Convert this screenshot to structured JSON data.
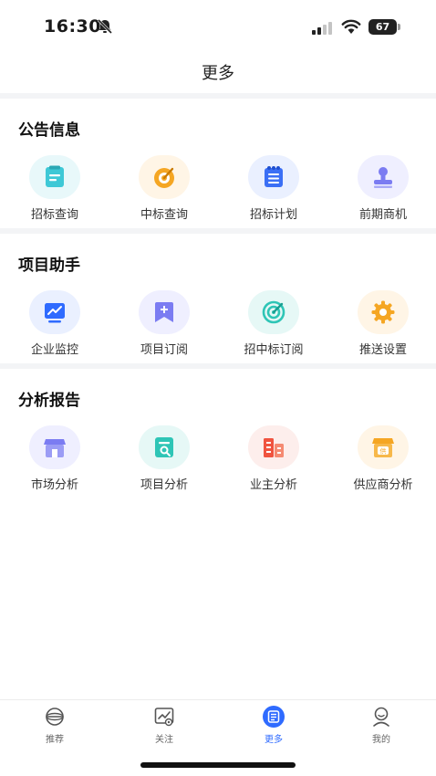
{
  "status_bar": {
    "time": "16:30",
    "battery": "67"
  },
  "header": {
    "title": "更多"
  },
  "sections": [
    {
      "title": "公告信息",
      "items": [
        {
          "label": "招标查询",
          "icon": "document-list-icon",
          "color": "#3ec8d6"
        },
        {
          "label": "中标查询",
          "icon": "target-dart-icon",
          "color": "#f5a623"
        },
        {
          "label": "招标计划",
          "icon": "notebook-icon",
          "color": "#3b6ff5"
        },
        {
          "label": "前期商机",
          "icon": "stamp-icon",
          "color": "#7b7cf2"
        }
      ]
    },
    {
      "title": "项目助手",
      "items": [
        {
          "label": "企业监控",
          "icon": "monitor-trend-icon",
          "color": "#2f6bff"
        },
        {
          "label": "项目订阅",
          "icon": "bookmark-plus-icon",
          "color": "#7b7cf2"
        },
        {
          "label": "招中标订阅",
          "icon": "target-arrow-icon",
          "color": "#2ec5b6"
        },
        {
          "label": "推送设置",
          "icon": "gear-icon",
          "color": "#f5a623"
        }
      ]
    },
    {
      "title": "分析报告",
      "items": [
        {
          "label": "市场分析",
          "icon": "store-icon",
          "color": "#7b7cf2"
        },
        {
          "label": "项目分析",
          "icon": "report-search-icon",
          "color": "#2ec5b6"
        },
        {
          "label": "业主分析",
          "icon": "buildings-icon",
          "color": "#f0533f"
        },
        {
          "label": "供应商分析",
          "icon": "supplier-shop-icon",
          "color": "#f5a623"
        }
      ]
    }
  ],
  "supplier_badge": "供",
  "tab_bar": {
    "tabs": [
      {
        "label": "推荐",
        "icon": "globe-icon"
      },
      {
        "label": "关注",
        "icon": "chart-watch-icon"
      },
      {
        "label": "更多",
        "icon": "list-icon",
        "active": true
      },
      {
        "label": "我的",
        "icon": "user-icon"
      }
    ]
  }
}
